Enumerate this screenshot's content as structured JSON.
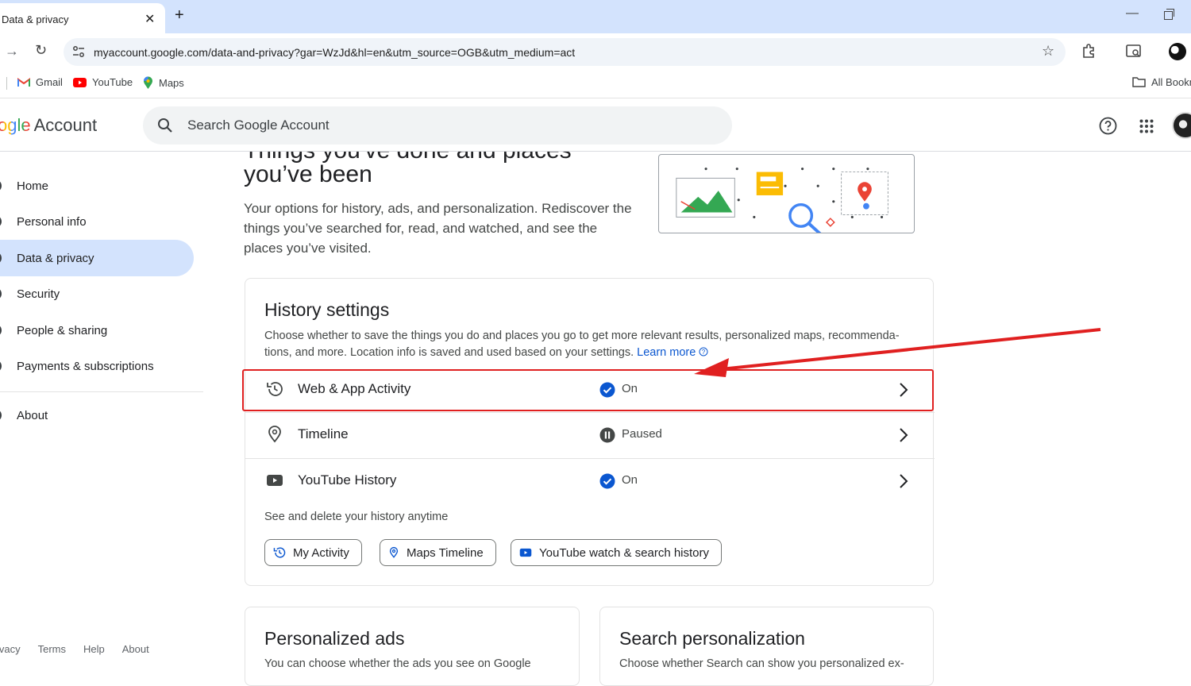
{
  "browser": {
    "tab_title": "Data & privacy",
    "tab_close": "✕",
    "new_tab": "+",
    "url": "myaccount.google.com/data-and-privacy?gar=WzJd&hl=en&utm_source=OGB&utm_medium=act",
    "bookmarks": [
      {
        "label": "Gmail",
        "icon": "gmail-icon"
      },
      {
        "label": "YouTube",
        "icon": "youtube-icon"
      },
      {
        "label": "Maps",
        "icon": "maps-icon"
      }
    ],
    "all_bookmarks": "All Bookm"
  },
  "header": {
    "logo_partial": "ogle",
    "logo_product": "Account",
    "search_placeholder": "Search Google Account"
  },
  "sidebar": {
    "items": [
      {
        "label": "Home"
      },
      {
        "label": "Personal info"
      },
      {
        "label": "Data & privacy",
        "active": true
      },
      {
        "label": "Security"
      },
      {
        "label": "People & sharing"
      },
      {
        "label": "Payments & subscriptions"
      }
    ],
    "about": "About",
    "footer": [
      "ivacy",
      "Terms",
      "Help",
      "About"
    ]
  },
  "main": {
    "heading_cut": "Things you've done and places",
    "heading_line2": "you’ve been",
    "intro": "Your options for history, ads, and personalization. Rediscover the things you’ve searched for, read, and watched, and see the places you’ve visited.",
    "history": {
      "title": "History settings",
      "description": "Choose whether to save the things you do and places you go to get more relevant results, personalized maps, recommenda-tions, and more. Location info is saved and used based on your settings.",
      "learn_more": "Learn more",
      "rows": [
        {
          "label": "Web & App Activity",
          "status": "On",
          "icon": "history-icon",
          "status_icon": "check-circle-icon"
        },
        {
          "label": "Timeline",
          "status": "Paused",
          "icon": "location-pin-icon",
          "status_icon": "pause-circle-icon"
        },
        {
          "label": "YouTube History",
          "status": "On",
          "icon": "youtube-icon",
          "status_icon": "check-circle-icon"
        }
      ],
      "see_delete": "See and delete your history anytime",
      "chips": [
        "My Activity",
        "Maps Timeline",
        "YouTube watch & search history"
      ]
    },
    "ads_card": {
      "title": "Personalized ads",
      "desc": "You can choose whether the ads you see on Google"
    },
    "search_card": {
      "title": "Search personalization",
      "desc": "Choose whether Search can show you personalized ex-"
    }
  },
  "colors": {
    "accent_blue": "#0b57d0",
    "active_nav": "#d3e3fd",
    "annotation_red": "#e02020"
  }
}
